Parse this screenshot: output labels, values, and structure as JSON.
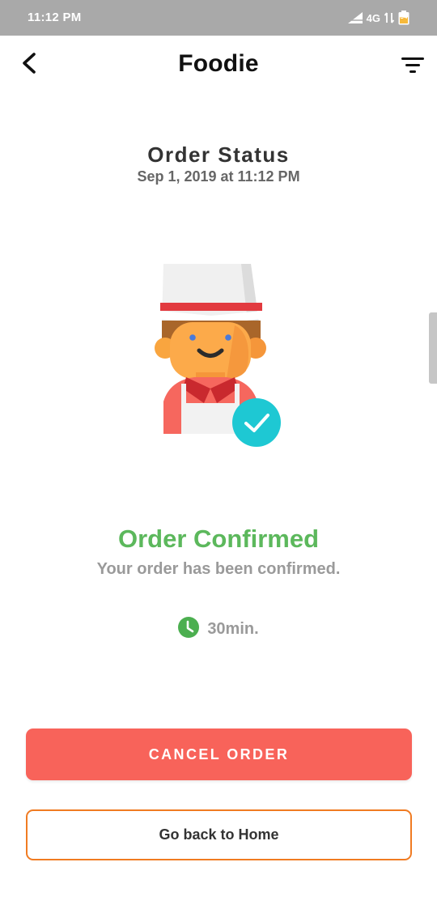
{
  "status_bar": {
    "time": "11:12 PM",
    "network": "4G",
    "battery": "34",
    "icons": [
      "signal-icon",
      "data-transfer-icon",
      "battery-icon"
    ]
  },
  "app_bar": {
    "title": "Foodie",
    "icons": [
      "back-arrow-icon",
      "filter-icon"
    ]
  },
  "order": {
    "heading": "Order Status",
    "date": "Sep 1, 2019 at 11:12 PM"
  },
  "illustration": {
    "icon": "chef-with-check-icon"
  },
  "confirmation": {
    "title": "Order Confirmed",
    "subtitle": "Your order has been confirmed.",
    "eta": "30min.",
    "eta_icon": "clock-icon"
  },
  "actions": {
    "cancel_label": "CANCEL ORDER",
    "home_label": "Go back to Home"
  },
  "colors": {
    "status_bar": "#a9a9a9",
    "success": "#5cb85c",
    "cancel": "#f8635a",
    "home_border": "#f07b22",
    "check_badge": "#1ec8d3"
  }
}
